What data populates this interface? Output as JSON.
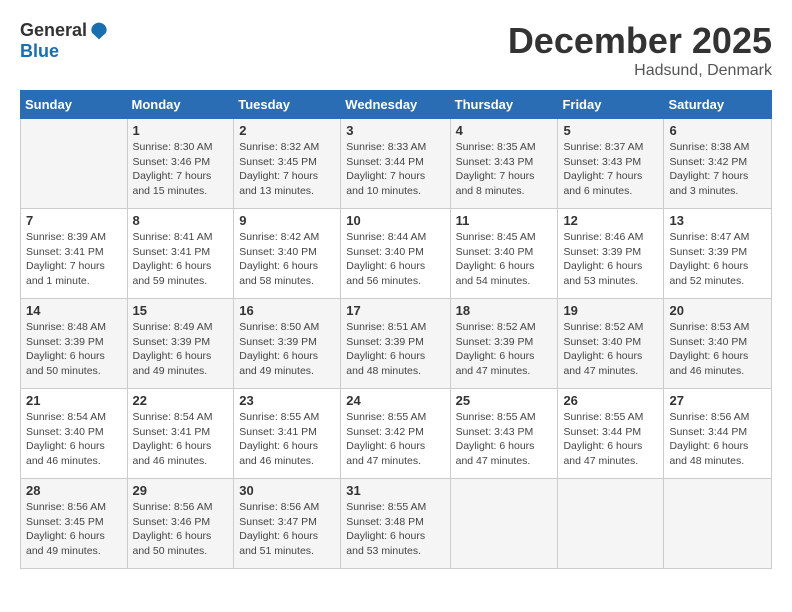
{
  "header": {
    "logo_general": "General",
    "logo_blue": "Blue",
    "month_year": "December 2025",
    "location": "Hadsund, Denmark"
  },
  "days_of_week": [
    "Sunday",
    "Monday",
    "Tuesday",
    "Wednesday",
    "Thursday",
    "Friday",
    "Saturday"
  ],
  "weeks": [
    [
      {
        "day": "",
        "info": ""
      },
      {
        "day": "1",
        "info": "Sunrise: 8:30 AM\nSunset: 3:46 PM\nDaylight: 7 hours\nand 15 minutes."
      },
      {
        "day": "2",
        "info": "Sunrise: 8:32 AM\nSunset: 3:45 PM\nDaylight: 7 hours\nand 13 minutes."
      },
      {
        "day": "3",
        "info": "Sunrise: 8:33 AM\nSunset: 3:44 PM\nDaylight: 7 hours\nand 10 minutes."
      },
      {
        "day": "4",
        "info": "Sunrise: 8:35 AM\nSunset: 3:43 PM\nDaylight: 7 hours\nand 8 minutes."
      },
      {
        "day": "5",
        "info": "Sunrise: 8:37 AM\nSunset: 3:43 PM\nDaylight: 7 hours\nand 6 minutes."
      },
      {
        "day": "6",
        "info": "Sunrise: 8:38 AM\nSunset: 3:42 PM\nDaylight: 7 hours\nand 3 minutes."
      }
    ],
    [
      {
        "day": "7",
        "info": "Sunrise: 8:39 AM\nSunset: 3:41 PM\nDaylight: 7 hours\nand 1 minute."
      },
      {
        "day": "8",
        "info": "Sunrise: 8:41 AM\nSunset: 3:41 PM\nDaylight: 6 hours\nand 59 minutes."
      },
      {
        "day": "9",
        "info": "Sunrise: 8:42 AM\nSunset: 3:40 PM\nDaylight: 6 hours\nand 58 minutes."
      },
      {
        "day": "10",
        "info": "Sunrise: 8:44 AM\nSunset: 3:40 PM\nDaylight: 6 hours\nand 56 minutes."
      },
      {
        "day": "11",
        "info": "Sunrise: 8:45 AM\nSunset: 3:40 PM\nDaylight: 6 hours\nand 54 minutes."
      },
      {
        "day": "12",
        "info": "Sunrise: 8:46 AM\nSunset: 3:39 PM\nDaylight: 6 hours\nand 53 minutes."
      },
      {
        "day": "13",
        "info": "Sunrise: 8:47 AM\nSunset: 3:39 PM\nDaylight: 6 hours\nand 52 minutes."
      }
    ],
    [
      {
        "day": "14",
        "info": "Sunrise: 8:48 AM\nSunset: 3:39 PM\nDaylight: 6 hours\nand 50 minutes."
      },
      {
        "day": "15",
        "info": "Sunrise: 8:49 AM\nSunset: 3:39 PM\nDaylight: 6 hours\nand 49 minutes."
      },
      {
        "day": "16",
        "info": "Sunrise: 8:50 AM\nSunset: 3:39 PM\nDaylight: 6 hours\nand 49 minutes."
      },
      {
        "day": "17",
        "info": "Sunrise: 8:51 AM\nSunset: 3:39 PM\nDaylight: 6 hours\nand 48 minutes."
      },
      {
        "day": "18",
        "info": "Sunrise: 8:52 AM\nSunset: 3:39 PM\nDaylight: 6 hours\nand 47 minutes."
      },
      {
        "day": "19",
        "info": "Sunrise: 8:52 AM\nSunset: 3:40 PM\nDaylight: 6 hours\nand 47 minutes."
      },
      {
        "day": "20",
        "info": "Sunrise: 8:53 AM\nSunset: 3:40 PM\nDaylight: 6 hours\nand 46 minutes."
      }
    ],
    [
      {
        "day": "21",
        "info": "Sunrise: 8:54 AM\nSunset: 3:40 PM\nDaylight: 6 hours\nand 46 minutes."
      },
      {
        "day": "22",
        "info": "Sunrise: 8:54 AM\nSunset: 3:41 PM\nDaylight: 6 hours\nand 46 minutes."
      },
      {
        "day": "23",
        "info": "Sunrise: 8:55 AM\nSunset: 3:41 PM\nDaylight: 6 hours\nand 46 minutes."
      },
      {
        "day": "24",
        "info": "Sunrise: 8:55 AM\nSunset: 3:42 PM\nDaylight: 6 hours\nand 47 minutes."
      },
      {
        "day": "25",
        "info": "Sunrise: 8:55 AM\nSunset: 3:43 PM\nDaylight: 6 hours\nand 47 minutes."
      },
      {
        "day": "26",
        "info": "Sunrise: 8:55 AM\nSunset: 3:44 PM\nDaylight: 6 hours\nand 47 minutes."
      },
      {
        "day": "27",
        "info": "Sunrise: 8:56 AM\nSunset: 3:44 PM\nDaylight: 6 hours\nand 48 minutes."
      }
    ],
    [
      {
        "day": "28",
        "info": "Sunrise: 8:56 AM\nSunset: 3:45 PM\nDaylight: 6 hours\nand 49 minutes."
      },
      {
        "day": "29",
        "info": "Sunrise: 8:56 AM\nSunset: 3:46 PM\nDaylight: 6 hours\nand 50 minutes."
      },
      {
        "day": "30",
        "info": "Sunrise: 8:56 AM\nSunset: 3:47 PM\nDaylight: 6 hours\nand 51 minutes."
      },
      {
        "day": "31",
        "info": "Sunrise: 8:55 AM\nSunset: 3:48 PM\nDaylight: 6 hours\nand 53 minutes."
      },
      {
        "day": "",
        "info": ""
      },
      {
        "day": "",
        "info": ""
      },
      {
        "day": "",
        "info": ""
      }
    ]
  ]
}
